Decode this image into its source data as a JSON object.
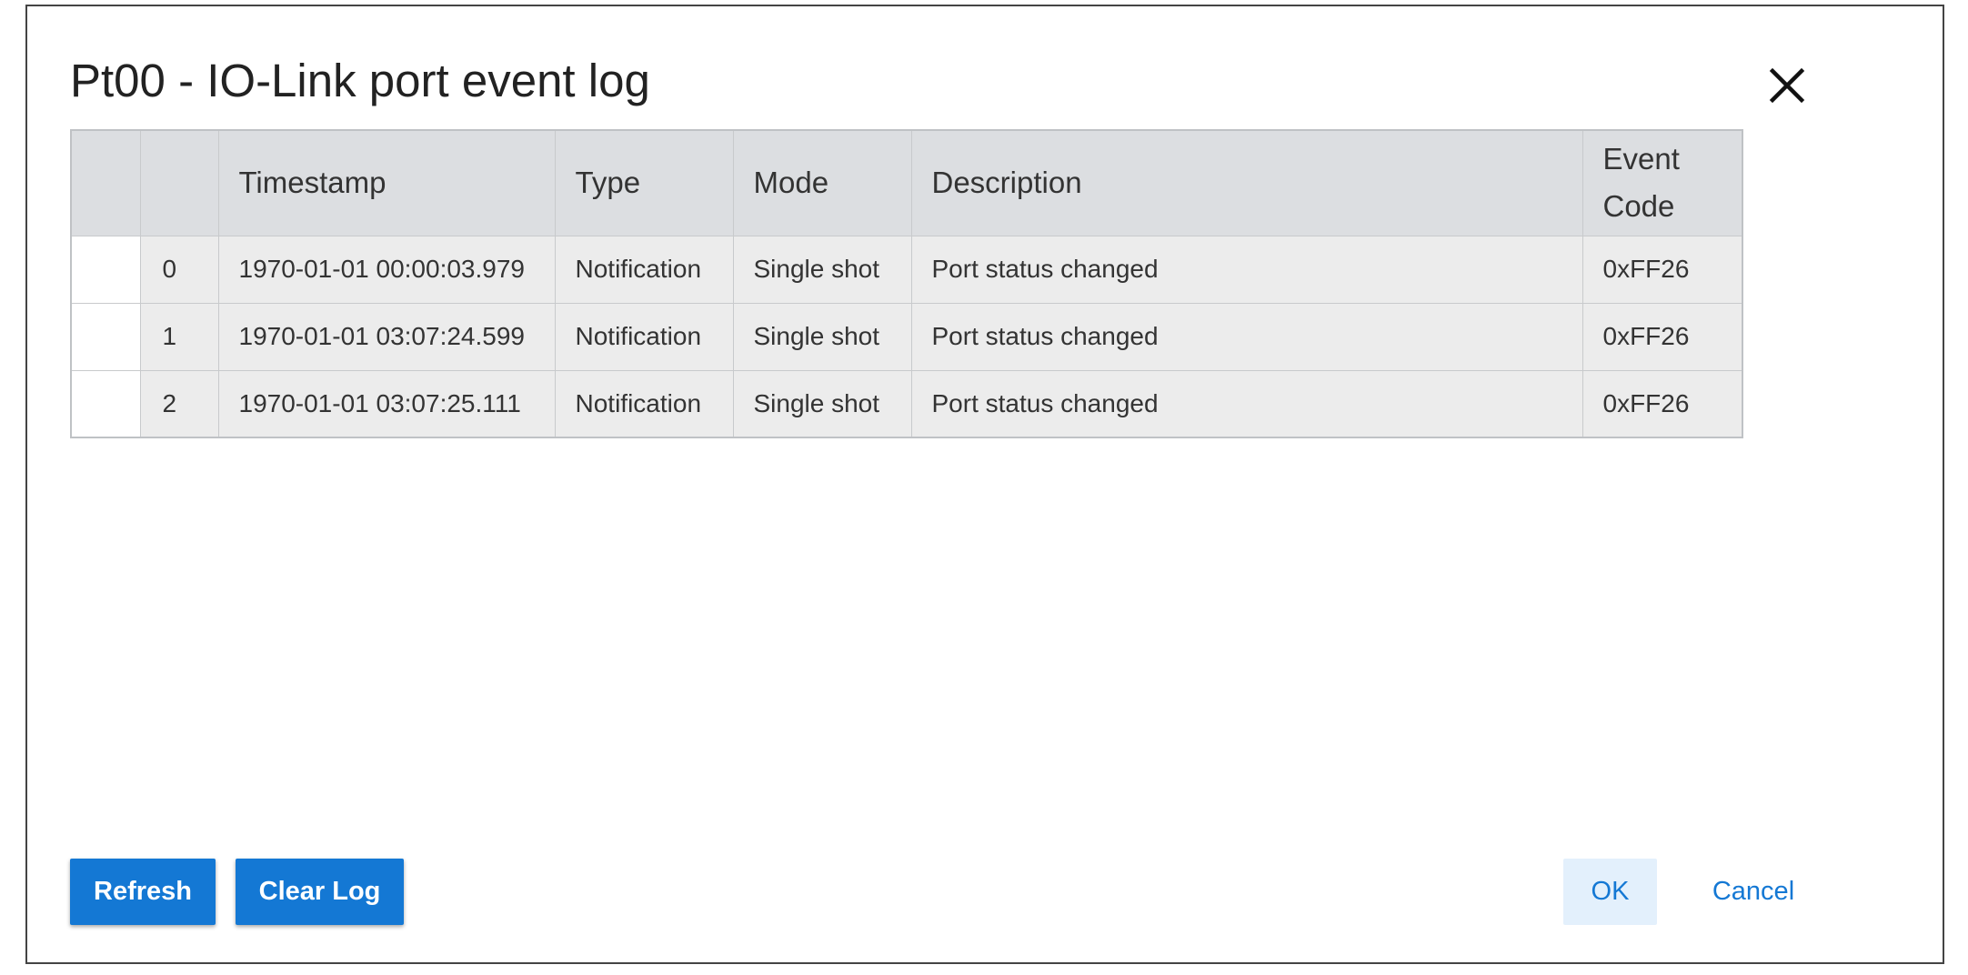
{
  "dialog": {
    "title": "Pt00 - IO-Link port event log",
    "close_icon": "close-icon"
  },
  "table": {
    "columns": [
      "",
      "",
      "Timestamp",
      "Type",
      "Mode",
      "Description",
      "Event Code"
    ],
    "rows": [
      {
        "index": "0",
        "timestamp": "1970-01-01 00:00:03.979",
        "type": "Notification",
        "mode": "Single shot",
        "description": "Port status changed",
        "event_code": "0xFF26"
      },
      {
        "index": "1",
        "timestamp": "1970-01-01 03:07:24.599",
        "type": "Notification",
        "mode": "Single shot",
        "description": "Port status changed",
        "event_code": "0xFF26"
      },
      {
        "index": "2",
        "timestamp": "1970-01-01 03:07:25.111",
        "type": "Notification",
        "mode": "Single shot",
        "description": "Port status changed",
        "event_code": "0xFF26"
      }
    ]
  },
  "buttons": {
    "refresh": "Refresh",
    "clear_log": "Clear Log",
    "ok": "OK",
    "cancel": "Cancel"
  },
  "colors": {
    "primary": "#1478d4",
    "header_bg": "#dcdee1",
    "row_bg": "#ececec"
  }
}
